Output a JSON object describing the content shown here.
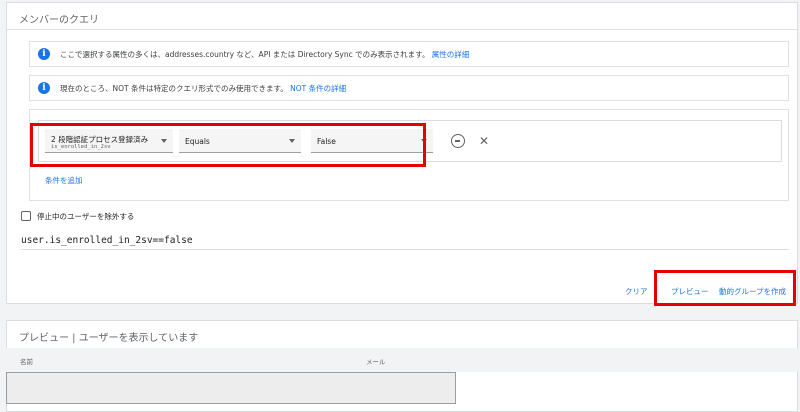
{
  "query_card": {
    "title": "メンバーのクエリ",
    "info_1": {
      "text": "ここで選択する属性の多くは、addresses.country など、API または Directory Sync でのみ表示されます。",
      "link": "属性の詳細"
    },
    "info_2": {
      "text": "現在のところ、NOT 条件は特定のクエリ形式でのみ使用できます。",
      "link": "NOT 条件の詳細"
    },
    "condition": {
      "attribute": {
        "label": "2 段階認証プロセス登録済み",
        "sub": "is_enrolled_in_2sv"
      },
      "operator": {
        "label": "Equals"
      },
      "value": {
        "label": "False"
      }
    },
    "add_condition_label": "条件を追加",
    "exclude_suspended_label": "停止中のユーザーを除外する",
    "query_string": "user.is_enrolled_in_2sv==false",
    "actions": {
      "clear_label": "クリア",
      "preview_label": "プレビュー",
      "create_label": "動的グループを作成"
    }
  },
  "preview_card": {
    "title": "プレビュー | ユーザーを表示しています",
    "columns": [
      "名前",
      "メール"
    ]
  },
  "colors": {
    "accent": "#1a73e8",
    "highlight": "#e60000"
  },
  "icons": {
    "info": "info-icon",
    "remove": "remove-circle-icon",
    "close": "close-icon",
    "dropdown": "chevron-down-icon"
  }
}
